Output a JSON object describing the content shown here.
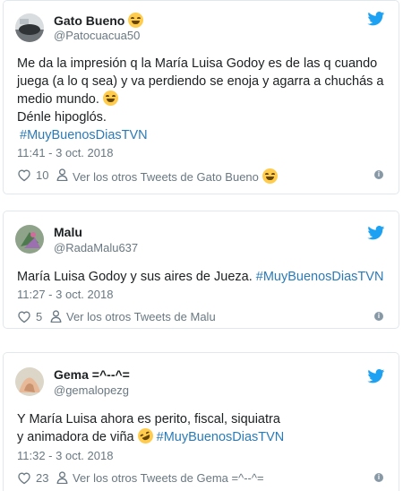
{
  "tweets": [
    {
      "user_name": "Gato Bueno",
      "handle": "@Patocuacua50",
      "text_lines": [
        "Me da la impresión q la María Luisa Godoy es de las q cuando",
        "juega (a lo q sea) y va perdiendo se enoja y agarra a chuchás a",
        "medio mundo.",
        "Dénle hipoglós."
      ],
      "hashtag": "#MuyBuenosDiasTVN",
      "time": "11:41 - 3 oct. 2018",
      "likes": "10",
      "others_label": "Ver los otros Tweets de Gato Bueno"
    },
    {
      "user_name": "Malu",
      "handle": "@RadaMalu637",
      "text": "María Luisa Godoy y sus aires de Jueza.",
      "hashtag": "#MuyBuenosDiasTVN",
      "time": "11:27 - 3 oct. 2018",
      "likes": "5",
      "others_label": "Ver los otros Tweets de Malu"
    },
    {
      "user_name": "Gema =^--^=",
      "handle": "@gemalopezg",
      "text_lines": [
        "Y María Luisa ahora es perito, fiscal, siquiatra",
        "y animadora de viña"
      ],
      "hashtag": "#MuyBuenosDiasTVN",
      "time": "11:32 - 3 oct. 2018",
      "likes": "23",
      "others_label": "Ver los otros Tweets de Gema =^--^="
    }
  ],
  "icons": {
    "twitter_bird": "twitter-bird-icon",
    "heart": "heart-icon",
    "person": "person-icon",
    "info": "info-icon",
    "emoji_grin": "grinning-face-emoji",
    "emoji_rofl": "rolling-laughing-emoji"
  },
  "colors": {
    "twitter_blue": "#1da1f2",
    "hashtag": "#2b7bb9",
    "muted": "#697882",
    "border": "#e1e8ed"
  }
}
